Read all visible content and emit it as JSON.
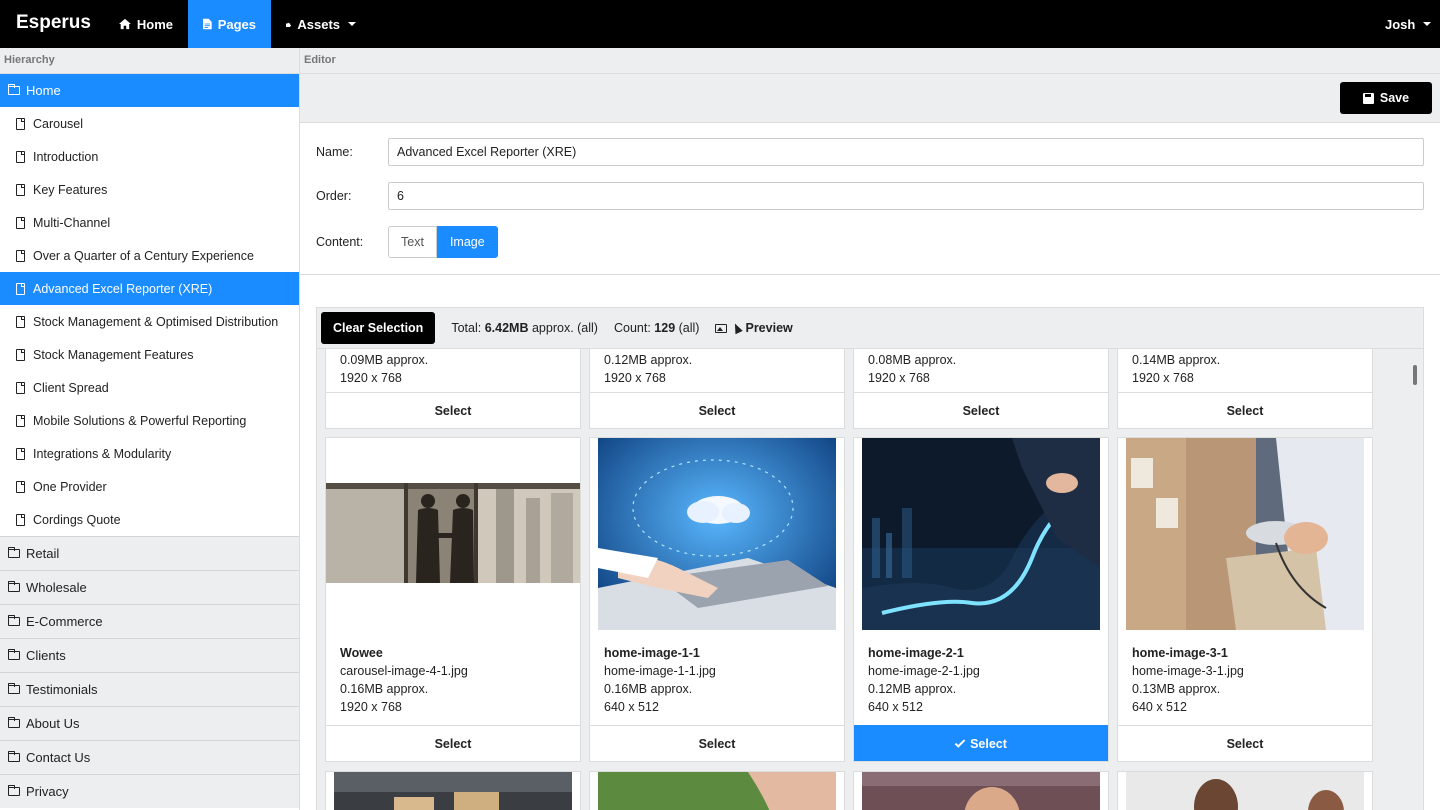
{
  "navbar": {
    "brand": "Esperus",
    "home": "Home",
    "pages": "Pages",
    "assets": "Assets",
    "user": "Josh"
  },
  "sidebar": {
    "heading": "Hierarchy",
    "root": "Home",
    "children": [
      "Carousel",
      "Introduction",
      "Key Features",
      "Multi-Channel",
      "Over a Quarter of a Century Experience",
      "Advanced Excel Reporter (XRE)",
      "Stock Management & Optimised Distribution",
      "Stock Management Features",
      "Client Spread",
      "Mobile Solutions & Powerful Reporting",
      "Integrations & Modularity",
      "One Provider",
      "Cordings Quote"
    ],
    "folders": [
      "Retail",
      "Wholesale",
      "E-Commerce",
      "Clients",
      "Testimonials",
      "About Us",
      "Contact Us",
      "Privacy"
    ]
  },
  "editor": {
    "heading": "Editor",
    "save_label": "Save",
    "name_label": "Name:",
    "name_value": "Advanced Excel Reporter (XRE)",
    "order_label": "Order:",
    "order_value": "6",
    "content_label": "Content:",
    "content_text": "Text",
    "content_image": "Image"
  },
  "media": {
    "clear_label": "Clear Selection",
    "total_prefix": "Total:",
    "total_value": "6.42MB",
    "total_suffix": "approx. (all)",
    "count_prefix": "Count:",
    "count_value": "129",
    "count_suffix": "(all)",
    "preview_label": "Preview",
    "select_label": "Select",
    "top_row": [
      {
        "size": "0.09MB approx.",
        "dims": "1920 x 768"
      },
      {
        "size": "0.12MB approx.",
        "dims": "1920 x 768"
      },
      {
        "size": "0.08MB approx.",
        "dims": "1920 x 768"
      },
      {
        "size": "0.14MB approx.",
        "dims": "1920 x 768"
      }
    ],
    "cards": [
      {
        "title": "Wowee",
        "file": "carousel-image-4-1.jpg",
        "size": "0.16MB approx.",
        "dims": "1920 x 768"
      },
      {
        "title": "home-image-1-1",
        "file": "home-image-1-1.jpg",
        "size": "0.16MB approx.",
        "dims": "640 x 512"
      },
      {
        "title": "home-image-2-1",
        "file": "home-image-2-1.jpg",
        "size": "0.12MB approx.",
        "dims": "640 x 512"
      },
      {
        "title": "home-image-3-1",
        "file": "home-image-3-1.jpg",
        "size": "0.13MB approx.",
        "dims": "640 x 512"
      }
    ]
  },
  "colors": {
    "accent": "#1a8cff",
    "navbar": "#000000",
    "panel": "#eceeef"
  }
}
